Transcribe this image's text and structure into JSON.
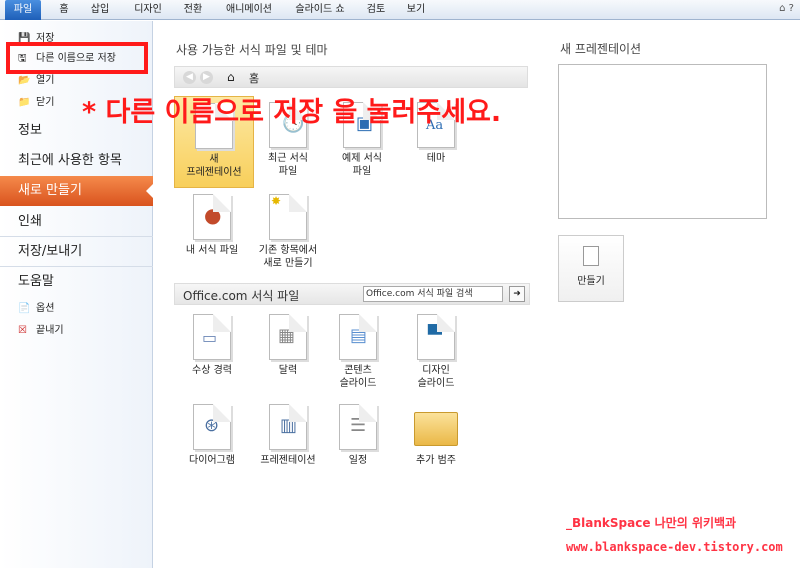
{
  "ribbon": {
    "tabs": [
      "파일",
      "홈",
      "삽입",
      "디자인",
      "전환",
      "애니메이션",
      "슬라이드 쇼",
      "검토",
      "보기"
    ],
    "window_controls": "⌂ ? "
  },
  "nav": {
    "small_top": [
      {
        "label": "저장",
        "icon": "save-icon"
      },
      {
        "label": "다른 이름으로 저장",
        "icon": "save-as-icon"
      },
      {
        "label": "열기",
        "icon": "folder-open-icon"
      },
      {
        "label": "닫기",
        "icon": "folder-close-icon"
      }
    ],
    "big": [
      "정보",
      "최근에 사용한 항목",
      "새로 만들기",
      "인쇄",
      "저장/보내기",
      "도움말"
    ],
    "active": "새로 만들기",
    "small_bottom": [
      {
        "label": "옵션",
        "icon": "options-icon"
      },
      {
        "label": "끝내기",
        "icon": "exit-icon"
      }
    ]
  },
  "main": {
    "title": "사용 가능한 서식 파일 및 테마",
    "breadcrumb_home": "홈",
    "templates": [
      {
        "label": "새\n프레젠테이션",
        "icon": "blank-doc-icon",
        "selected": true
      },
      {
        "label": "최근 서식\n파일",
        "icon": "clock-doc-icon"
      },
      {
        "label": "예제 서식\n파일",
        "icon": "monitor-doc-icon"
      },
      {
        "label": "테마",
        "icon": "theme-doc-icon"
      },
      {
        "label": "내 서식 파일",
        "icon": "user-doc-icon"
      },
      {
        "label": "기존 항목에서\n새로 만들기",
        "icon": "new-from-existing-icon"
      }
    ],
    "office_title": "Office.com 서식 파일",
    "office_search_placeholder": "Office.com 서식 파일 검색",
    "office_templates": [
      {
        "label": "수상 경력",
        "icon": "award-doc-icon"
      },
      {
        "label": "달력",
        "icon": "calendar-doc-icon"
      },
      {
        "label": "콘텐츠\n슬라이드",
        "icon": "content-slide-icon"
      },
      {
        "label": "디자인\n슬라이드",
        "icon": "design-slide-icon"
      },
      {
        "label": "다이어그램",
        "icon": "diagram-doc-icon"
      },
      {
        "label": "프레젠테이션",
        "icon": "presentation-doc-icon"
      },
      {
        "label": "일정",
        "icon": "schedule-doc-icon"
      },
      {
        "label": "추가 범주",
        "icon": "folder-icon"
      }
    ]
  },
  "right": {
    "title": "새 프레젠테이션",
    "create_label": "만들기"
  },
  "overlay": {
    "note": "* 다른 이름으로 저장 을 눌러주세요.",
    "watermark1": "_BlankSpace 나만의 위키백과",
    "watermark2": "www.blankspace-dev.tistory.com"
  },
  "colors": {
    "accent": "#d9531e",
    "annotation": "#ff1a1a"
  }
}
